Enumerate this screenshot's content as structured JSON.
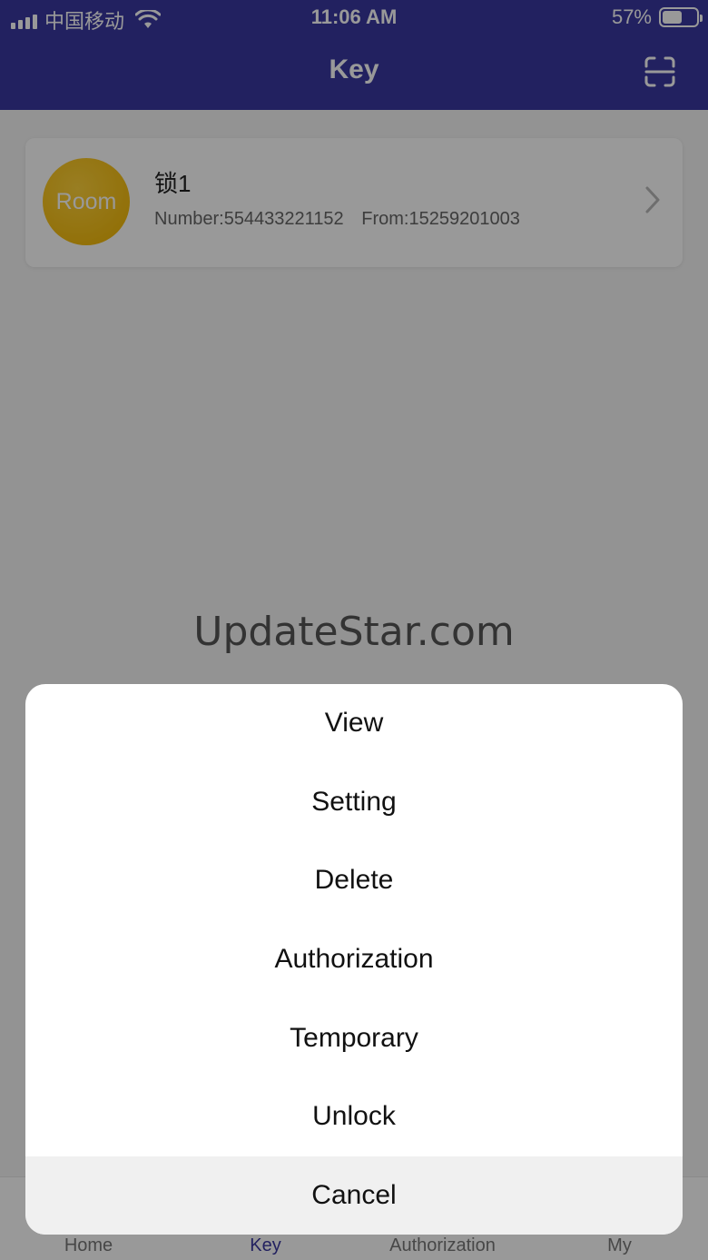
{
  "status_bar": {
    "carrier": "中国移动",
    "time": "11:06 AM",
    "battery_text": "57%",
    "battery_level": 0.57
  },
  "header": {
    "title": "Key",
    "scan_icon": "scan-icon"
  },
  "key_card": {
    "avatar_text": "Room",
    "name": "锁1",
    "number": "Number:554433221152",
    "from": "From:15259201003"
  },
  "tabs": [
    {
      "label": "Home",
      "active": false
    },
    {
      "label": "Key",
      "active": true
    },
    {
      "label": "Authorization",
      "active": false
    },
    {
      "label": "My",
      "active": false
    }
  ],
  "watermark": "UpdateStar.com",
  "action_sheet": {
    "items": [
      "View",
      "Setting",
      "Delete",
      "Authorization",
      "Temporary",
      "Unlock"
    ],
    "cancel": "Cancel"
  },
  "colors": {
    "primary": "#3a38a0",
    "avatar": "#f0b400"
  }
}
